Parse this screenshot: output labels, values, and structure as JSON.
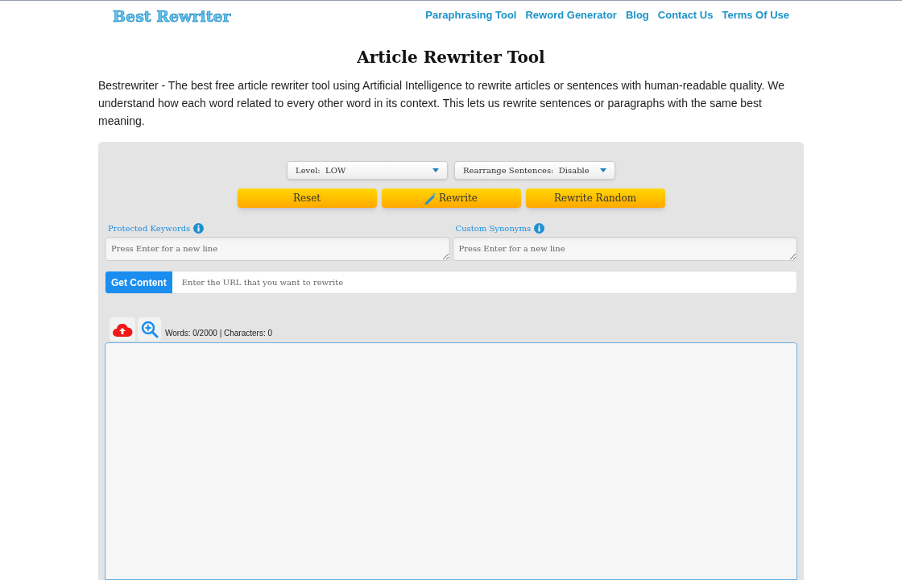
{
  "logo": "Best Rewriter",
  "nav": [
    {
      "label": "Paraphrasing Tool"
    },
    {
      "label": "Reword Generator"
    },
    {
      "label": "Blog"
    },
    {
      "label": "Contact Us"
    },
    {
      "label": "Terms Of Use"
    }
  ],
  "title": "Article Rewriter Tool",
  "intro": "Bestrewriter - The best free article rewriter tool using Artificial Intelligence to rewrite articles or sentences with human-readable quality. We understand how each word related to every other word in its context. This lets us rewrite sentences or paragraphs with the same best meaning.",
  "selects": [
    {
      "value": "Level:  LOW"
    },
    {
      "value": "Rearrange Sentences:  Disable"
    }
  ],
  "buttons": [
    {
      "label": "Reset",
      "kind": "plain"
    },
    {
      "label": "Rewrite",
      "kind": "wand"
    },
    {
      "label": "Rewrite Random",
      "kind": "plain"
    }
  ],
  "fields": [
    {
      "label": "Protected Keywords",
      "placeholder": "Press Enter for a new line"
    },
    {
      "label": "Custom Synonyms",
      "placeholder": "Press Enter for a new line"
    }
  ],
  "url_bar": {
    "button": "Get Content",
    "placeholder": "Enter the URL that you want to rewrite"
  },
  "counter": "Words: 0/2000 | Characters: 0"
}
